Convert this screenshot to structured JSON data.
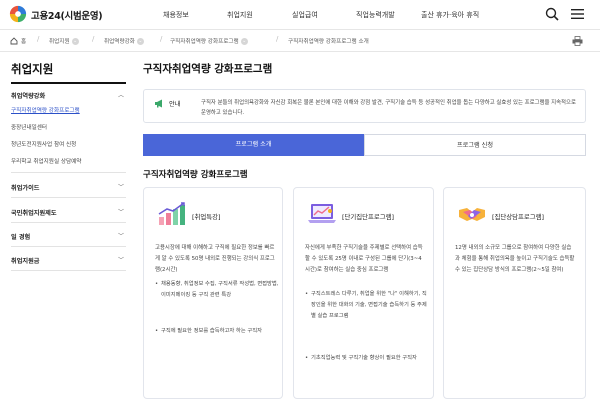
{
  "header": {
    "logo": "고용24(시범운영)",
    "nav": [
      "채용정보",
      "취업지원",
      "실업급여",
      "직업능력개발",
      "출산 휴가·육아 휴직"
    ],
    "brand_colors": [
      "#e8553d",
      "#2f7bd8",
      "#f3b21b",
      "#3db06a"
    ]
  },
  "breadcrumb": [
    "홈",
    "취업지원",
    "취업역량강화",
    "구직자취업역량 강화프로그램",
    "구직자취업역량 강화프로그램 소개"
  ],
  "sidebar": {
    "title": "취업지원",
    "groups": [
      {
        "label": "취업역량강화",
        "items": [
          "구직자취업역량 강화프로그램",
          "중장년내일센터",
          "청년도전지원사업 참여 신청",
          "우리학교 취업지원실 상담예약"
        ]
      },
      {
        "label": "취업가이드"
      },
      {
        "label": "국민취업지원제도"
      },
      {
        "label": "일 경험"
      },
      {
        "label": "취업지원금"
      }
    ]
  },
  "main": {
    "title": "구직자취업역량 강화프로그램",
    "notice_label": "안내",
    "notice_text": "구직자 분들의 취업의욕강화와 자신감 회복은 물론 본인에 대한 이해와 강점 발견, 구직기술 습득 등 성공적인 취업을 돕는 다양하고 실효성 있는 프로그램을 지속적으로 운영하고 있습니다.",
    "tabs": [
      "프로그램 소개",
      "프로그램 신청"
    ],
    "section_title": "구직자취업역량 강화프로그램",
    "cards": [
      {
        "title": "[취업특강]",
        "desc": "고용시장에 대해 이해하고 구직에 필요한 정보를 빠르게 알 수 있도록 50명 내외로 진행되는 강의식 프로그램(2시간)",
        "bullets": [
          "채용동향, 취업정보 수집, 구직서류 작성법, 면접방법, 이미지메이킹 등 구직 관련 특강",
          "구직에 필요한 정보를 습득하고자 하는 구직자"
        ]
      },
      {
        "title": "[단기집단프로그램]",
        "desc": "자신에게 부족한 구직기술을 주제별로 선택하여 습득할 수 있도록 25명 이내로 구성된 그룹에 단기(3~4시간)로 참여하는 실습 중심 프로그램",
        "bullets": [
          "구직스트레스 다루기, 취업을 위한 \"나\" 이해하기, 직장인을 위한 대화의 기술, 면접기술 습득하기 등 주제별 실습 프로그램",
          "기초직업능력 및 구직기술 향상이 필요한 구직자"
        ]
      },
      {
        "title": "[집단상담프로그램]",
        "desc": "12명 내외의 소규모 그룹으로 참여하여 다양한 실습과 체험을 통해 취업의욕을 높이고 구직기술도 습득할 수 있는 집단상담 방식의 프로그램(2~5일 참여)",
        "bullets": []
      }
    ]
  },
  "icons": [
    "logo-mark",
    "search-icon",
    "menu-icon",
    "home-icon",
    "print-icon",
    "megaphone-icon",
    "chart-growth-icon",
    "laptop-chart-icon",
    "handshake-icon"
  ]
}
